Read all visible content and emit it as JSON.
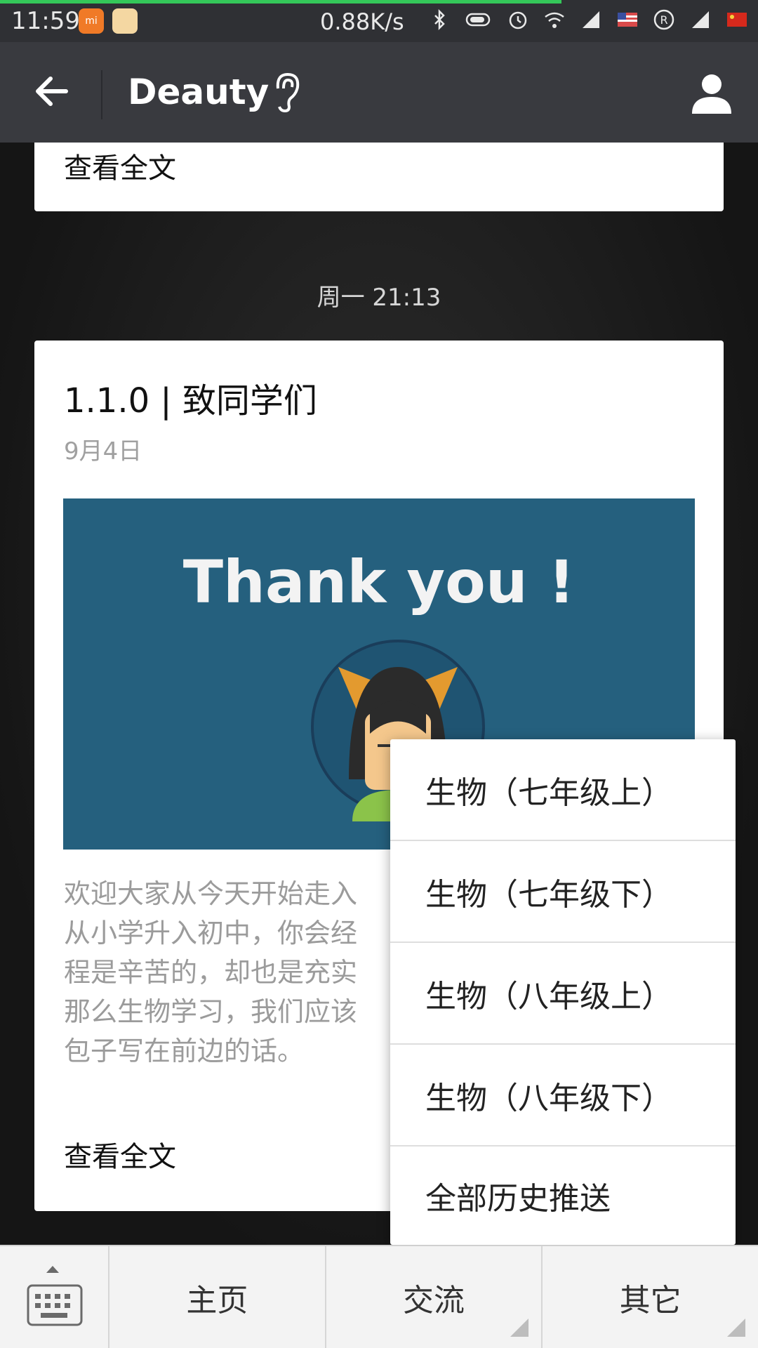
{
  "status_bar": {
    "time": "11:59",
    "network_speed": "0.88K/s",
    "icons": [
      "mi-icon",
      "notification-icon",
      "bluetooth-icon",
      "battery-icon",
      "alarm-icon",
      "wifi-icon",
      "signal-icon",
      "flag-us-icon",
      "registered-icon",
      "signal-icon",
      "flag-cn-icon"
    ]
  },
  "header": {
    "title": "Deauty"
  },
  "chat": {
    "top_card": {
      "read_more": "查看全文"
    },
    "timestamp": "周一 21:13",
    "article": {
      "title": "1.1.0 | 致同学们",
      "date": "9月4日",
      "cover_text": "Thank you !",
      "excerpt_lines": [
        "欢迎大家从今天开始走入",
        "从小学升入初中，你会经",
        "程是辛苦的，却也是充实",
        "那么生物学习，我们应该",
        "包子写在前边的话。"
      ],
      "read_more": "查看全文"
    }
  },
  "popup_menu": {
    "items": [
      "生物（七年级上）",
      "生物（七年级下）",
      "生物（八年级上）",
      "生物（八年级下）",
      "全部历史推送"
    ]
  },
  "bottom_nav": {
    "tabs": [
      "主页",
      "交流",
      "其它"
    ]
  },
  "colors": {
    "header_bg": "#393a3f",
    "cover_bg": "#25607e"
  }
}
